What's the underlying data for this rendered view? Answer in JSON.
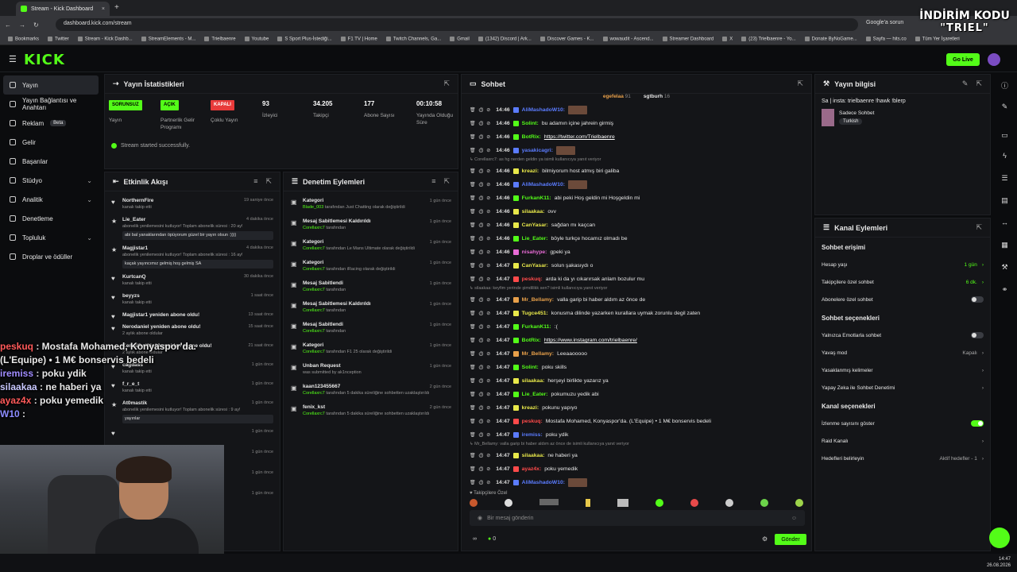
{
  "browser": {
    "tab_title": "Stream - Kick Dashboard",
    "url": "dashboard.kick.com/stream",
    "google_action": "Google'a sorun",
    "bookmarks": [
      "Bookmarks",
      "Twitter",
      "Stream - Kick Dashb...",
      "StreamElements - M...",
      "Trielbaenre",
      "Youtube",
      "S Sport Plus-İstediği...",
      "F1 TV | Home",
      "Twitch Channels, Ga...",
      "Gmail",
      "(1342) Discord | Ark...",
      "Discover Games - K...",
      "wowaudit - Ascend...",
      "Streamer Dashboard",
      "X",
      "(23) Trielbaenre - Yo...",
      "Donate ByNoGame...",
      "Sayfa — hits.co",
      "Tüm Yer İşaretleri"
    ]
  },
  "overlay_title": {
    "line1": "İNDİRİM KODU",
    "line2": "\"TRIEL\""
  },
  "header": {
    "logo": "KICK",
    "go_live": "Go Live"
  },
  "sidebar": {
    "items": [
      {
        "label": "Yayın"
      },
      {
        "label": "Yayın Bağlantısı ve Anahtarı"
      },
      {
        "label": "Reklam",
        "badge": "Beta"
      },
      {
        "label": "Gelir"
      },
      {
        "label": "Başarılar"
      },
      {
        "label": "Stüdyo"
      },
      {
        "label": "Analitik"
      },
      {
        "label": "Denetleme"
      },
      {
        "label": "Topluluk"
      },
      {
        "label": "Droplar ve ödüller"
      }
    ]
  },
  "stats_panel": {
    "title": "Yayın İstatistikleri",
    "items": [
      {
        "badge": "SORUNSUZ",
        "label": "Yayın"
      },
      {
        "badge": "AÇIK",
        "label": "Partnerlik Gelir Programı"
      },
      {
        "badge": "KAPALI",
        "label": "Çoklu Yayın"
      },
      {
        "value": "93",
        "label": "İzleyici"
      },
      {
        "value": "34.205",
        "label": "Takipçi"
      },
      {
        "value": "177",
        "label": "Abone Sayısı"
      },
      {
        "value": "00:10:58",
        "label": "Yayında Olduğu Süre"
      }
    ],
    "success": "Stream started successfully."
  },
  "activity": {
    "title": "Etkinlik Akışı",
    "events": [
      {
        "name": "NorthernFire",
        "sub": "kanalı takip etti",
        "time": "19 saniye önce"
      },
      {
        "name": "Lie_Eater",
        "sub": "abonelik yenilemesini kutluyor! Toplam abonelik süresi : 20 ay!",
        "quote": "abi bal yanaklarından öpüyorum güzel bir yayın olsun :))))",
        "time": "4 dakika önce"
      },
      {
        "name": "Magjistar1",
        "sub": "abonelik yenilemesini kutluyor! Toplam abonelik süresi : 16 ay!",
        "quote": "kaçak yayıncımız gelmiş hoş gelmiş SA",
        "time": "4 dakika önce"
      },
      {
        "name": "KurtcanQ",
        "sub": "kanalı takip etti",
        "time": "30 dakika önce"
      },
      {
        "name": "beyyzs",
        "sub": "kanalı takip etti",
        "time": "1 saat önce"
      },
      {
        "name": "Magjistar1 yeniden abone oldu!",
        "sub": "",
        "time": "13 saat önce"
      },
      {
        "name": "Nerodaniel yeniden abone oldu!",
        "sub": "2 aylık abone oldular",
        "time": "15 saat önce"
      },
      {
        "name": "KemalSwiftie13 yeniden abone oldu!",
        "sub": "2 aylık abone oldular",
        "time": "21 saat önce"
      },
      {
        "name": "cagdass",
        "sub": "kanalı takip etti",
        "time": "1 gün önce"
      },
      {
        "name": "f_r_e_t",
        "sub": "kanalı takip etti",
        "time": "1 gün önce"
      },
      {
        "name": "At0mastik",
        "sub": "abonelik yenilemesini kutluyor! Toplam abonelik süresi : 9 ay!",
        "quote": "yayınlar",
        "time": "1 gün önce"
      },
      {
        "name": "",
        "sub": "",
        "time": "1 gün önce"
      },
      {
        "name": "",
        "sub": "",
        "time": "1 gün önce"
      },
      {
        "name": "",
        "sub": "",
        "time": "1 gün önce"
      },
      {
        "name": "",
        "sub": "",
        "time": "1 gün önce"
      }
    ]
  },
  "moderation": {
    "title": "Denetim Eylemleri",
    "items": [
      {
        "title": "Kategori",
        "actor": "Blade_003",
        "detail": "tarafından Just Chatting olarak değiştirildi",
        "time": "1 gün önce"
      },
      {
        "title": "Mesaj Sabitlemesi Kaldırıldı",
        "actor": "Corellaxrc7",
        "detail": "tarafından",
        "time": "1 gün önce"
      },
      {
        "title": "Kategori",
        "actor": "Corellaxrc7",
        "detail": "tarafından Le Mans Ultimate olarak değiştirildi",
        "time": "1 gün önce"
      },
      {
        "title": "Kategori",
        "actor": "Corellaxrc7",
        "detail": "tarafından iRacing olarak değiştirildi",
        "time": "1 gün önce"
      },
      {
        "title": "Mesaj Sabitlendi",
        "actor": "Corellaxrc7",
        "detail": "tarafından",
        "time": "1 gün önce"
      },
      {
        "title": "Mesaj Sabitlemesi Kaldırıldı",
        "actor": "Corellaxrc7",
        "detail": "tarafından",
        "time": "1 gün önce"
      },
      {
        "title": "Mesaj Sabitlendi",
        "actor": "Corellaxrc7",
        "detail": "tarafından",
        "time": "1 gün önce"
      },
      {
        "title": "Kategori",
        "actor": "Corellaxrc7",
        "detail": "tarafından F1 25 olarak değiştirildi",
        "time": "1 gün önce"
      },
      {
        "title": "Unban Request",
        "actor": "",
        "detail": "was submitted by ak1nception",
        "time": "1 gün önce"
      },
      {
        "title": "kaan123455667",
        "actor": "Corellaxrc7",
        "detail": "tarafından 5 dakika süreliğine sohbetten uzaklaştırıldı",
        "time": "2 gün önce"
      },
      {
        "title": "fenix_kst",
        "actor": "Corellaxrc7",
        "detail": "tarafından 5 dakika süreliğine sohbetten uzaklaştırıldı",
        "time": "2 gün önce"
      }
    ]
  },
  "chat": {
    "title": "Sohbet",
    "top_users": [
      {
        "name": "egefelaa",
        "count": "91"
      },
      {
        "name": "sgtburh",
        "count": "16"
      }
    ],
    "messages": [
      {
        "time": "14:46",
        "user": "AliMashadoW10",
        "color": "#5b7cff",
        "text": "",
        "emote": true
      },
      {
        "time": "14:46",
        "user": "Solint",
        "color": "#53fc18",
        "text": "bu adamın içine jahrein girmiş"
      },
      {
        "time": "14:46",
        "user": "BotRix",
        "color": "#53fc18",
        "text": "https://twitter.com/Trielbaenre",
        "link": true
      },
      {
        "time": "14:46",
        "user": "yasakicagri",
        "color": "#5b7cff",
        "text": "",
        "emote": true
      },
      {
        "reply": "Corellaxrc7: as hg nerden geldin ya isimli kullanıcıya yanıt veriyor"
      },
      {
        "time": "14:46",
        "user": "kreazi",
        "color": "#e8e84a",
        "text": "bilmiyorum host atmış biri galiba"
      },
      {
        "time": "14:46",
        "user": "AliMashadoW10",
        "color": "#5b7cff",
        "text": "",
        "emote": true
      },
      {
        "time": "14:46",
        "user": "FurkanK11",
        "color": "#53fc18",
        "text": "abi peki Hoş geldin mi Hoşgeldin mi"
      },
      {
        "time": "14:46",
        "user": "silaakaa",
        "color": "#e8e84a",
        "text": "ovv"
      },
      {
        "time": "14:46",
        "user": "CanYasar",
        "color": "#e8e84a",
        "text": "sağdan mı kaçcan"
      },
      {
        "time": "14:46",
        "user": "Lie_Eater",
        "color": "#53fc18",
        "text": "böyle turkçe hocamız olmadı be"
      },
      {
        "time": "14:46",
        "user": "nisahype",
        "color": "#e86bd6",
        "text": "gpeki ya"
      },
      {
        "time": "14:47",
        "user": "CanYasar",
        "color": "#e8e84a",
        "text": "solun şakasıydı o"
      },
      {
        "time": "14:47",
        "user": "peskuq",
        "color": "#ff4a4a",
        "text": "arda ki da yı cıkarırsak anlam bozulur mu"
      },
      {
        "reply": "silaakaa: keyfim yerinde şimdilikk sen? isimli kullanıcıya yanıt veriyor"
      },
      {
        "time": "14:47",
        "user": "Mr_Bellamy",
        "color": "#e8a04a",
        "text": "valla garip bi haber aldım az önce de"
      },
      {
        "time": "14:47",
        "user": "Tugce451",
        "color": "#e8e84a",
        "text": "konusma dilinde yazarken kurallara uymak zorunlu degil zaten"
      },
      {
        "time": "14:47",
        "user": "FurkanK11",
        "color": "#53fc18",
        "text": ":("
      },
      {
        "time": "14:47",
        "user": "BotRix",
        "color": "#53fc18",
        "text": "https://www.instagram.com/trielbaenre/",
        "link": true
      },
      {
        "time": "14:47",
        "user": "Mr_Bellamy",
        "color": "#e8a04a",
        "text": "Leeaaooooo"
      },
      {
        "time": "14:47",
        "user": "Solint",
        "color": "#53fc18",
        "text": "poku skills"
      },
      {
        "time": "14:47",
        "user": "silaakaa",
        "color": "#e8e84a",
        "text": "herşeyi birlikte yazarız ya"
      },
      {
        "time": "14:47",
        "user": "Lie_Eater",
        "color": "#53fc18",
        "text": "pokumuzu yedik abi"
      },
      {
        "time": "14:47",
        "user": "kreazi",
        "color": "#e8e84a",
        "text": "pokunu yapıyo"
      },
      {
        "time": "14:47",
        "user": "peskuq",
        "color": "#ff4a4a",
        "text": "Mostafa Mohamed, Konyaspor'da. (L'Equipe)  •  1 M€ bonservis bedeli"
      },
      {
        "time": "14:47",
        "user": "iremiss",
        "color": "#5b7cff",
        "text": "poku ydik"
      },
      {
        "reply": "Mr_Bellamy: valla garip bi haber aldım az önce de isimli kullanıcıya yanıt veriyor"
      },
      {
        "time": "14:47",
        "user": "silaakaa",
        "color": "#e8e84a",
        "text": "ne haberi ya"
      },
      {
        "time": "14:47",
        "user": "ayaz4x",
        "color": "#ff4a4a",
        "text": "poku yemedik"
      },
      {
        "time": "14:47",
        "user": "AliMashadoW10",
        "color": "#5b7cff",
        "text": "",
        "emote": true
      }
    ],
    "followers_only": "Takipçilere Özel",
    "input_placeholder": "Bir mesaj gönderin",
    "counter": "0",
    "send": "Gönder"
  },
  "stream_info": {
    "title": "Yayın bilgisi",
    "stream_title": "Sa | insta: trielbaenre !hawk !blerp",
    "category": "Sadece Sohbet",
    "language": "Turkish"
  },
  "channel_actions": {
    "title": "Kanal Eylemleri",
    "chat_access": "Sohbet erişimi",
    "rows1": [
      {
        "label": "Hesap yaşı",
        "value": "1 gün"
      },
      {
        "label": "Takipçilere özel sohbet",
        "value": "6 dk."
      },
      {
        "label": "Abonelere özel sohbet",
        "toggle": false
      }
    ],
    "chat_options": "Sohbet seçenekleri",
    "rows2": [
      {
        "label": "Yalnızca Emotlarla sohbet",
        "toggle": false
      },
      {
        "label": "Yavaş mod",
        "value": "Kapalı"
      },
      {
        "label": "Yasaklanmış kelimeler",
        "value": ""
      },
      {
        "label": "Yapay Zeka ile Sohbet Denetimi",
        "value": ""
      }
    ],
    "channel_options": "Kanal seçenekleri",
    "rows3": [
      {
        "label": "İzlenme sayısını göster",
        "toggle": true
      },
      {
        "label": "Raid Kanalı",
        "value": ""
      },
      {
        "label": "Hedefleri belirleyin",
        "value": "Aktif hedefler - 1"
      }
    ]
  },
  "overlay_chat": [
    {
      "user": "peskuq",
      "color": "#ff5a5a",
      "text": ": Mostafa Mohamed, Konyaspor'da."
    },
    {
      "user": "",
      "color": "#fff",
      "text": "(L'Equipe)  •  1 M€ bonservis bedeli"
    },
    {
      "user": "iremiss",
      "color": "#a08cff",
      "text": ": poku ydik"
    },
    {
      "user": "silaakaa",
      "color": "#c8c8ff",
      "text": ": ne haberi ya"
    },
    {
      "user": "ayaz4x",
      "color": "#ff5a5a",
      "text": ": poku yemedik"
    },
    {
      "user": "W10",
      "color": "#8c8cff",
      "text": ":"
    }
  ],
  "taskbar": {
    "time": "14:47",
    "date": "26.08.2026"
  }
}
